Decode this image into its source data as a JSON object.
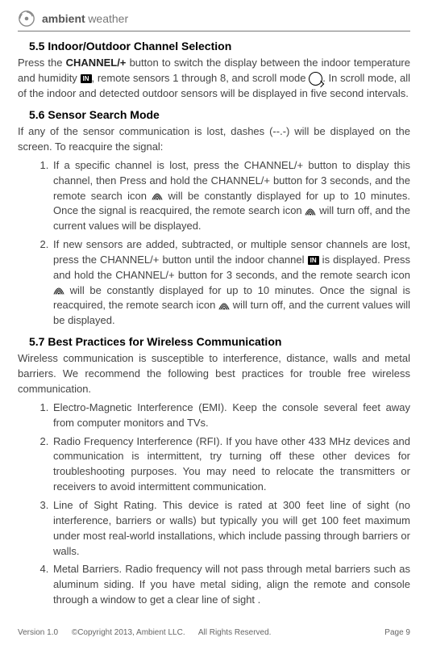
{
  "brand": {
    "bold": "ambient",
    "thin": "weather"
  },
  "s55": {
    "title": "5.5 Indoor/Outdoor Channel Selection",
    "p1a": "Press the ",
    "p1b": "CHANNEL/+",
    "p1c": " button to switch the display between the indoor temperature and humidity ",
    "p1d": ", remote sensors 1 through 8, and scroll mode ",
    "p1e": ". In scroll mode, all of the indoor and detected outdoor sensors will be displayed in five second intervals."
  },
  "s56": {
    "title": "5.6  Sensor Search Mode",
    "intro": "If any of the sensor communication is lost, dashes (--.-) will be displayed on the screen. To reacquire the signal:",
    "li1a": "If a specific channel is lost, press the ",
    "li1b": "CHANNEL/+",
    "li1c": " button to display this channel, then Press and hold the ",
    "li1d": "CHANNEL/+",
    "li1e": " button for 3 seconds, and the remote search icon ",
    "li1f": " will be constantly displayed for up to 10 minutes. Once the signal is reacquired, the remote search icon ",
    "li1g": " will turn off, and the current values will be displayed.",
    "li2a": "If new sensors are added, subtracted, or multiple sensor channels are lost, press the ",
    "li2b": "CHANNEL/+",
    "li2c": " button until the indoor channel ",
    "li2d": " is displayed. Press and hold the ",
    "li2e": "CHANNEL/+",
    "li2f": " button for 3 seconds, and the remote search icon ",
    "li2g": " will be constantly displayed for up to 10 minutes. Once the signal is reacquired, the remote search icon ",
    "li2h": " will turn off, and the current values will be displayed."
  },
  "s57": {
    "title": "5.7 Best Practices for Wireless Communication",
    "intro": "Wireless communication is susceptible to interference, distance, walls and metal barriers. We recommend the following best practices for trouble free wireless communication.",
    "li1b": "Electro-Magnetic Interference (EMI).",
    "li1t": " Keep the console several feet away from computer monitors and TVs.",
    "li2b": "Radio Frequency Interference (RFI).",
    "li2t": " If you have other 433 MHz devices and communication is intermittent, try turning off these other devices for troubleshooting purposes. You may need to relocate the transmitters or receivers to avoid intermittent communication.",
    "li3b": "Line of Sight Rating.",
    "li3t": " This device is rated at 300 feet line of sight (no interference, barriers or walls) but typically you will get 100 feet maximum under most real-world installations, which include passing through barriers or walls.",
    "li4b": "Metal Barriers.",
    "li4t": " Radio frequency will not pass through metal barriers such as aluminum siding. If you have metal siding, align the remote and console through a window to get a clear line of sight ."
  },
  "footer": {
    "version": "Version 1.0",
    "copyright": "©Copyright 2013, Ambient  LLC.",
    "rights": "All Rights Reserved.",
    "page": "Page 9"
  },
  "icons": {
    "in_label": "IN"
  }
}
